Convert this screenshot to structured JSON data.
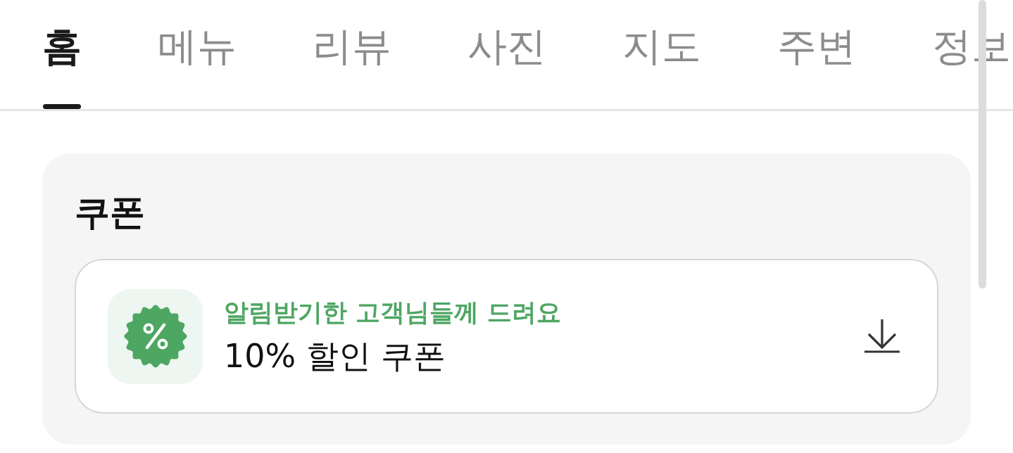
{
  "tabs": [
    {
      "label": "홈",
      "selected": true
    },
    {
      "label": "메뉴",
      "selected": false
    },
    {
      "label": "리뷰",
      "selected": false
    },
    {
      "label": "사진",
      "selected": false
    },
    {
      "label": "지도",
      "selected": false
    },
    {
      "label": "주변",
      "selected": false
    },
    {
      "label": "정보",
      "selected": false
    }
  ],
  "coupon_section": {
    "title": "쿠폰",
    "coupon": {
      "caption": "알림받기한 고객님들께 드려요",
      "name": "10% 할인 쿠폰"
    }
  }
}
